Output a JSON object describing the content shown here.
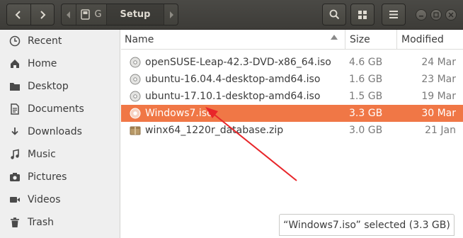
{
  "header": {
    "path_home_label": "G",
    "path_current": "Setup"
  },
  "sidebar": {
    "items": [
      {
        "label": "Recent",
        "icon": "clock-icon"
      },
      {
        "label": "Home",
        "icon": "home-icon"
      },
      {
        "label": "Desktop",
        "icon": "folder-icon"
      },
      {
        "label": "Documents",
        "icon": "document-icon"
      },
      {
        "label": "Downloads",
        "icon": "download-icon"
      },
      {
        "label": "Music",
        "icon": "music-icon"
      },
      {
        "label": "Pictures",
        "icon": "camera-icon"
      },
      {
        "label": "Videos",
        "icon": "video-icon"
      },
      {
        "label": "Trash",
        "icon": "trash-icon"
      }
    ]
  },
  "columns": {
    "name": "Name",
    "size": "Size",
    "modified": "Modified"
  },
  "files": [
    {
      "name": "openSUSE-Leap-42.3-DVD-x86_64.iso",
      "size": "4.6 GB",
      "modified": "24 Mar",
      "icon": "disc-icon"
    },
    {
      "name": "ubuntu-16.04.4-desktop-amd64.iso",
      "size": "1.6 GB",
      "modified": "23 Mar",
      "icon": "disc-icon"
    },
    {
      "name": "ubuntu-17.10.1-desktop-amd64.iso",
      "size": "1.5 GB",
      "modified": "19 Mar",
      "icon": "disc-icon"
    },
    {
      "name": "Windows7.iso",
      "size": "3.3 GB",
      "modified": "30 Mar",
      "icon": "disc-icon",
      "selected": true
    },
    {
      "name": "winx64_1220r_database.zip",
      "size": "3.0 GB",
      "modified": "21 Jan",
      "icon": "archive-icon"
    }
  ],
  "status": {
    "text": "“Windows7.iso” selected  (3.3 GB)"
  },
  "colors": {
    "selection": "#f07746",
    "annotation_arrow": "#e8262a"
  }
}
